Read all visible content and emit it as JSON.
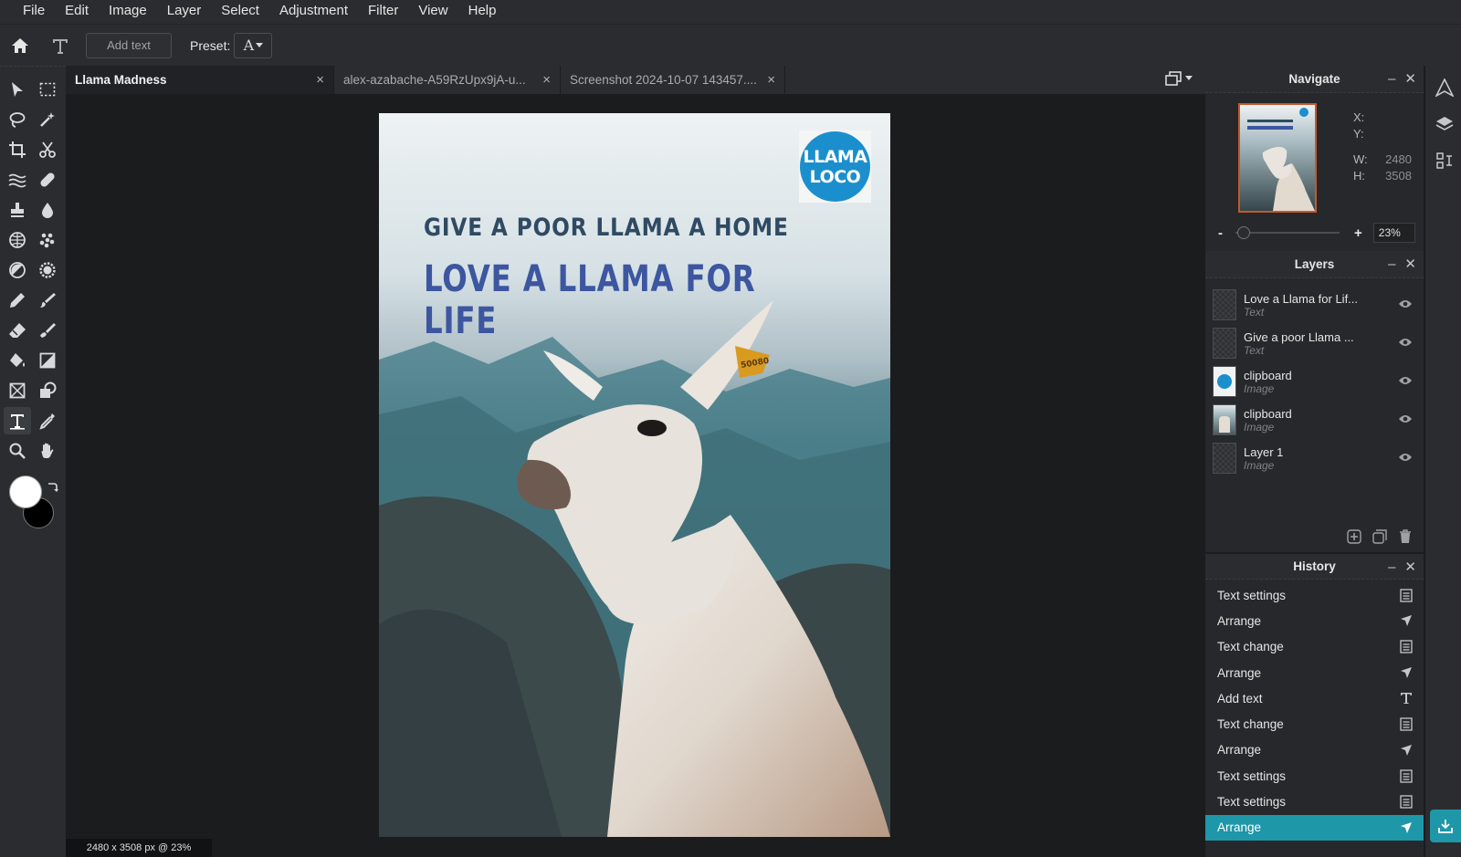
{
  "menu": [
    "File",
    "Edit",
    "Image",
    "Layer",
    "Select",
    "Adjustment",
    "Filter",
    "View",
    "Help"
  ],
  "options": {
    "add_text_label": "Add text",
    "preset_label": "Preset:",
    "preset_glyph": "A"
  },
  "tabs": [
    {
      "label": "Llama Madness",
      "active": true
    },
    {
      "label": "alex-azabache-A59RzUpx9jA-u...",
      "active": false
    },
    {
      "label": "Screenshot 2024-10-07 143457....",
      "active": false
    }
  ],
  "tab_close_glyph": "×",
  "document": {
    "headline_small": "GIVE A POOR LLAMA A HOME",
    "headline_large": "LOVE A LLAMA FOR LIFE",
    "logo_line1": "LLAMA",
    "logo_line2": "LOCO",
    "ear_tag": "50080"
  },
  "status_text": "2480 x 3508 px @ 23%",
  "navigate": {
    "title": "Navigate",
    "x_label": "X:",
    "y_label": "Y:",
    "x_value": "",
    "y_value": "",
    "w_label": "W:",
    "w_value": "2480",
    "h_label": "H:",
    "h_value": "3508",
    "zoom_minus": "-",
    "zoom_plus": "+",
    "zoom_value": "23%",
    "zoom_slider_fraction": 0.02
  },
  "layers": {
    "title": "Layers",
    "items": [
      {
        "name": "Love a Llama for Lif...",
        "type": "Text",
        "thumb": "empty"
      },
      {
        "name": "Give a poor Llama ...",
        "type": "Text",
        "thumb": "empty"
      },
      {
        "name": "clipboard",
        "type": "Image",
        "thumb": "logo"
      },
      {
        "name": "clipboard",
        "type": "Image",
        "thumb": "photo"
      },
      {
        "name": "Layer 1",
        "type": "Image",
        "thumb": "empty"
      }
    ]
  },
  "history": {
    "title": "History",
    "items": [
      {
        "label": "Text settings",
        "icon": "document-icon"
      },
      {
        "label": "Arrange",
        "icon": "arrow-icon"
      },
      {
        "label": "Text change",
        "icon": "document-icon"
      },
      {
        "label": "Arrange",
        "icon": "arrow-icon"
      },
      {
        "label": "Add text",
        "icon": "text-icon"
      },
      {
        "label": "Text change",
        "icon": "document-icon"
      },
      {
        "label": "Arrange",
        "icon": "arrow-icon"
      },
      {
        "label": "Text settings",
        "icon": "document-icon"
      },
      {
        "label": "Text settings",
        "icon": "document-icon"
      },
      {
        "label": "Arrange",
        "icon": "arrow-icon",
        "active": true
      }
    ]
  },
  "colors": {
    "accent": "#1e97a9",
    "foreground": "#ffffff",
    "background": "#000000",
    "nav_border": "#c3592e"
  }
}
